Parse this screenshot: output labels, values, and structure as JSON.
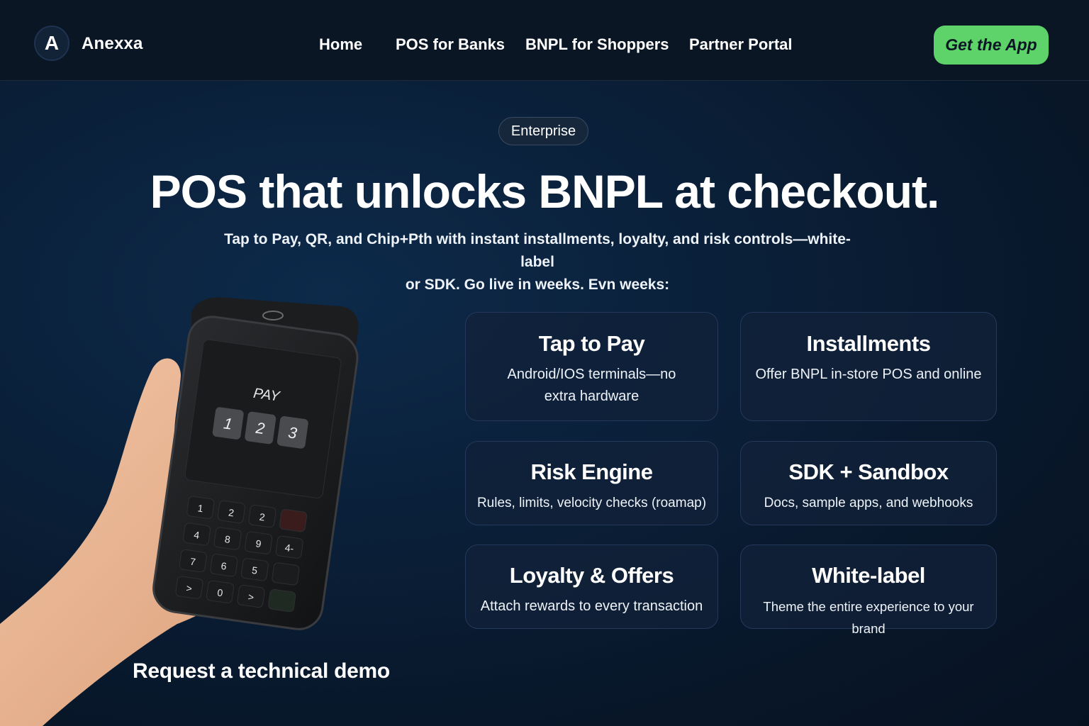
{
  "header": {
    "logo_letter": "A",
    "brand": "Anexxa",
    "nav": [
      "Home",
      "POS for Banks",
      "BNPL for Shoppers",
      "Partner Portal"
    ],
    "cta_label": "Get the App"
  },
  "hero": {
    "badge": "Enterprise",
    "title": "POS that unlocks BNPL at checkout.",
    "subtitle_line1": "Tap to Pay, QR, and Chip+Pth with instant installments, loyalty, and risk controls—white-label",
    "subtitle_line2": "or SDK. Go live in weeks. Evn weeks:"
  },
  "device": {
    "screen_label": "PAY",
    "screen_digits": [
      "1",
      "2",
      "3"
    ],
    "keypad": [
      "1",
      "2",
      "2",
      "",
      "4",
      "8",
      "9",
      "4-",
      "7",
      "6",
      "5",
      "",
      ">",
      "0",
      ">",
      ""
    ]
  },
  "features": [
    {
      "title": "Tap to Pay",
      "desc": "Android/IOS terminals—no extra hardware"
    },
    {
      "title": "Installments",
      "desc": "Offer BNPL in-store POS and online"
    },
    {
      "title": "Risk Engine",
      "desc": "Rules, limits, velocity checks (roamap)"
    },
    {
      "title": "SDK + Sandbox",
      "desc": "Docs, sample apps, and webhooks"
    },
    {
      "title": "Loyalty & Offers",
      "desc": "Attach rewards to every transaction"
    },
    {
      "title": "White-label",
      "desc": "Theme the entire experience to your brand"
    }
  ],
  "demo_link": "Request a technical demo",
  "colors": {
    "cta_green": "#5dd36a",
    "background": "#0a1f38",
    "card_border": "#24385a"
  }
}
